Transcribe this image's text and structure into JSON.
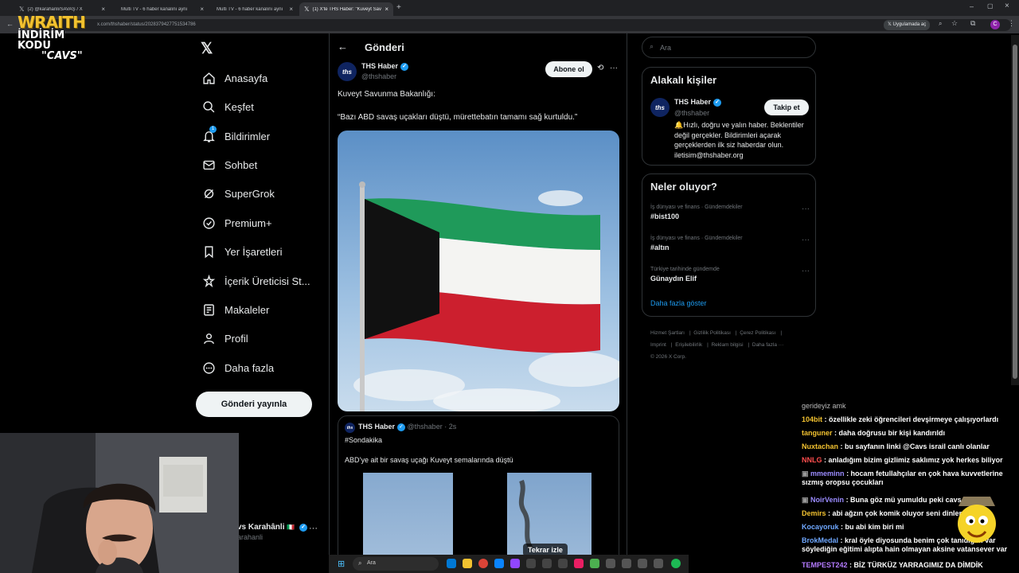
{
  "browser": {
    "tabs": [
      {
        "label": "(2) @karahanli/SAVAŞ / X",
        "active": false
      },
      {
        "label": "Multi TV - 6 haber kanalını aynı",
        "active": false
      },
      {
        "label": "Multi TV - 6 haber kanalını aynı",
        "active": false
      },
      {
        "label": "(1) X'te THS Haber: \"Kuveyt Sav",
        "active": true
      }
    ],
    "url": "x.com/thshaber/status/2028379427751534786",
    "open_app_label": "Uygulamada aç",
    "profile_initial": "C"
  },
  "overlay": {
    "brand": "WRAITH",
    "code_label": "İNDİRİM KODU",
    "code": "\"CAVS\""
  },
  "nav": {
    "items": [
      {
        "label": "Anasayfa",
        "icon": "home-icon"
      },
      {
        "label": "Keşfet",
        "icon": "search-icon"
      },
      {
        "label": "Bildirimler",
        "icon": "bell-icon",
        "badge": "1"
      },
      {
        "label": "Sohbet",
        "icon": "mail-icon"
      },
      {
        "label": "SuperGrok",
        "icon": "grok-icon"
      },
      {
        "label": "Premium+",
        "icon": "verified-icon"
      },
      {
        "label": "Yer İşaretleri",
        "icon": "bookmark-icon"
      },
      {
        "label": "İçerik Üreticisi St...",
        "icon": "creator-icon"
      },
      {
        "label": "Makaleler",
        "icon": "article-icon"
      },
      {
        "label": "Profil",
        "icon": "person-icon"
      },
      {
        "label": "Daha fazla",
        "icon": "more-circle-icon"
      }
    ],
    "post_button": "Gönderi yayınla",
    "account_name": "vs Karahânli",
    "account_handle": "arahanli"
  },
  "post": {
    "header_title": "Gönderi",
    "author": "THS Haber",
    "handle": "@thshaber",
    "avatar_text": "ths",
    "subscribe_label": "Abone ol",
    "line1": "Kuveyt Savunma Bakanlığı:",
    "line2": "“Bazı ABD savaş uçakları düştü, mürettebatın tamamı sağ kurtuldu.”",
    "quote": {
      "author": "THS Haber",
      "handle": "@thshaber",
      "time": "· 2s",
      "tag": "#Sondakika",
      "text": "ABD’ye ait bir savaş uçağı Kuveyt semalarında düştü",
      "replay_label": "Tekrar izle"
    }
  },
  "right": {
    "search_placeholder": "Ara",
    "related_title": "Alakalı kişiler",
    "person": {
      "name": "THS Haber",
      "handle": "@thshaber",
      "follow_label": "Takip et",
      "bio": "🔔Hızlı, doğru ve yalın haber. Beklentiler değil gerçekler. Bildirimleri açarak gerçeklerden ilk siz haberdar olun. iletisim@thshaber.org"
    },
    "trends_title": "Neler oluyor?",
    "trends": [
      {
        "category": "İş dünyası ve finans · Gündemdekiler",
        "name": "#bist100"
      },
      {
        "category": "İş dünyası ve finans · Gündemdekiler",
        "name": "#altın"
      },
      {
        "category": "Türkiye tarihinde gündemde",
        "name": "Günaydın Elif"
      }
    ],
    "show_more": "Daha fazla göster",
    "footer": {
      "terms": "Hizmet Şartları",
      "privacy": "Gizlilik Politikası",
      "cookie": "Çerez Politikası",
      "imprint": "Imprint",
      "access": "Erişilebilirlik",
      "ads": "Reklam bilgisi",
      "more": "Daha fazla ···",
      "copyright": "© 2026 X Corp."
    }
  },
  "chat": {
    "messages": [
      {
        "user": "",
        "text": "gerideyiz amk",
        "color": "#bbbbbb"
      },
      {
        "user": "104bit",
        "text": ": özellikle zeki öğrencileri devşirmeye çalışıyorlardı",
        "color": "#f2c230"
      },
      {
        "user": "tanguner",
        "text": ": daha doğrusu bir kişi kandırıldı",
        "color": "#f2c230"
      },
      {
        "user": "Nuxtachan",
        "text": ": bu sayfanın linki @Cavs israil canlı olanlar",
        "color": "#f2c230"
      },
      {
        "user": "NNLG",
        "text": ": anladığım bizim gizlimiz saklımız yok herkes biliyor",
        "color": "#ff4d4d"
      },
      {
        "user": "mmeminn",
        "text": ": hocam fetullahçılar en çok hava kuvvetlerine sızmış oropsu çocukları",
        "color": "#9b8cff"
      },
      {
        "user": "NoirVenin",
        "text": ": Buna göz mü yumuldu peki cavs",
        "color": "#9b8cff"
      },
      {
        "user": "Demirs",
        "text": ": abi ağzın çok komik oluyor seni dinlemedi",
        "color": "#f2c230"
      },
      {
        "user": "Kocayoruk",
        "text": ": bu abi kim biri mi",
        "color": "#6fa8ff"
      },
      {
        "user": "BrokMedal",
        "text": ": kral öyle diyosunda benim çok tanıdığım var söylediğin eğitimi alıpta hain olmayan aksine vatansever var",
        "color": "#6fa8ff"
      },
      {
        "user": "TEMPEST242",
        "text": ": BİZ TÜRKÜZ YARRAGIMIZ DA DİMDİK",
        "color": "#b57bff"
      }
    ]
  },
  "taskbar": {
    "search_placeholder": "Ara"
  }
}
